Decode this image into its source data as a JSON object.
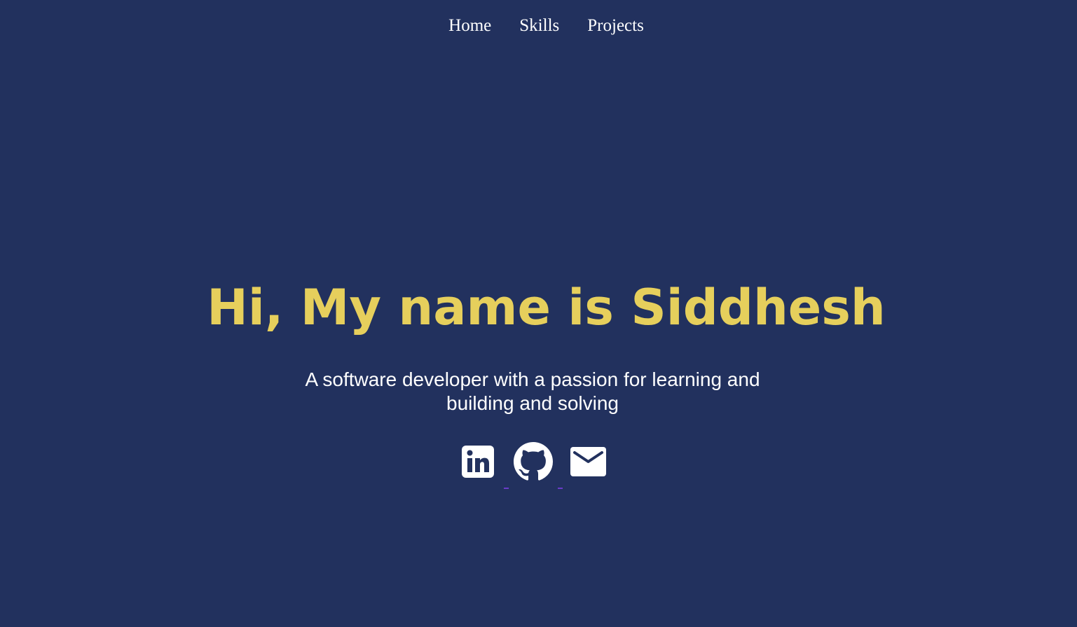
{
  "nav": {
    "items": [
      {
        "label": "Home"
      },
      {
        "label": "Skills"
      },
      {
        "label": "Projects"
      }
    ]
  },
  "hero": {
    "title": "Hi, My name is Siddhesh",
    "subtitle": "A software developer with a passion for learning and building and solving"
  },
  "socials": {
    "items": [
      {
        "icon": "linkedin-icon"
      },
      {
        "icon": "github-icon"
      },
      {
        "icon": "mail-icon"
      }
    ]
  },
  "colors": {
    "background": "#22315e",
    "accent": "#e6cf5c",
    "text": "#ffffff"
  }
}
